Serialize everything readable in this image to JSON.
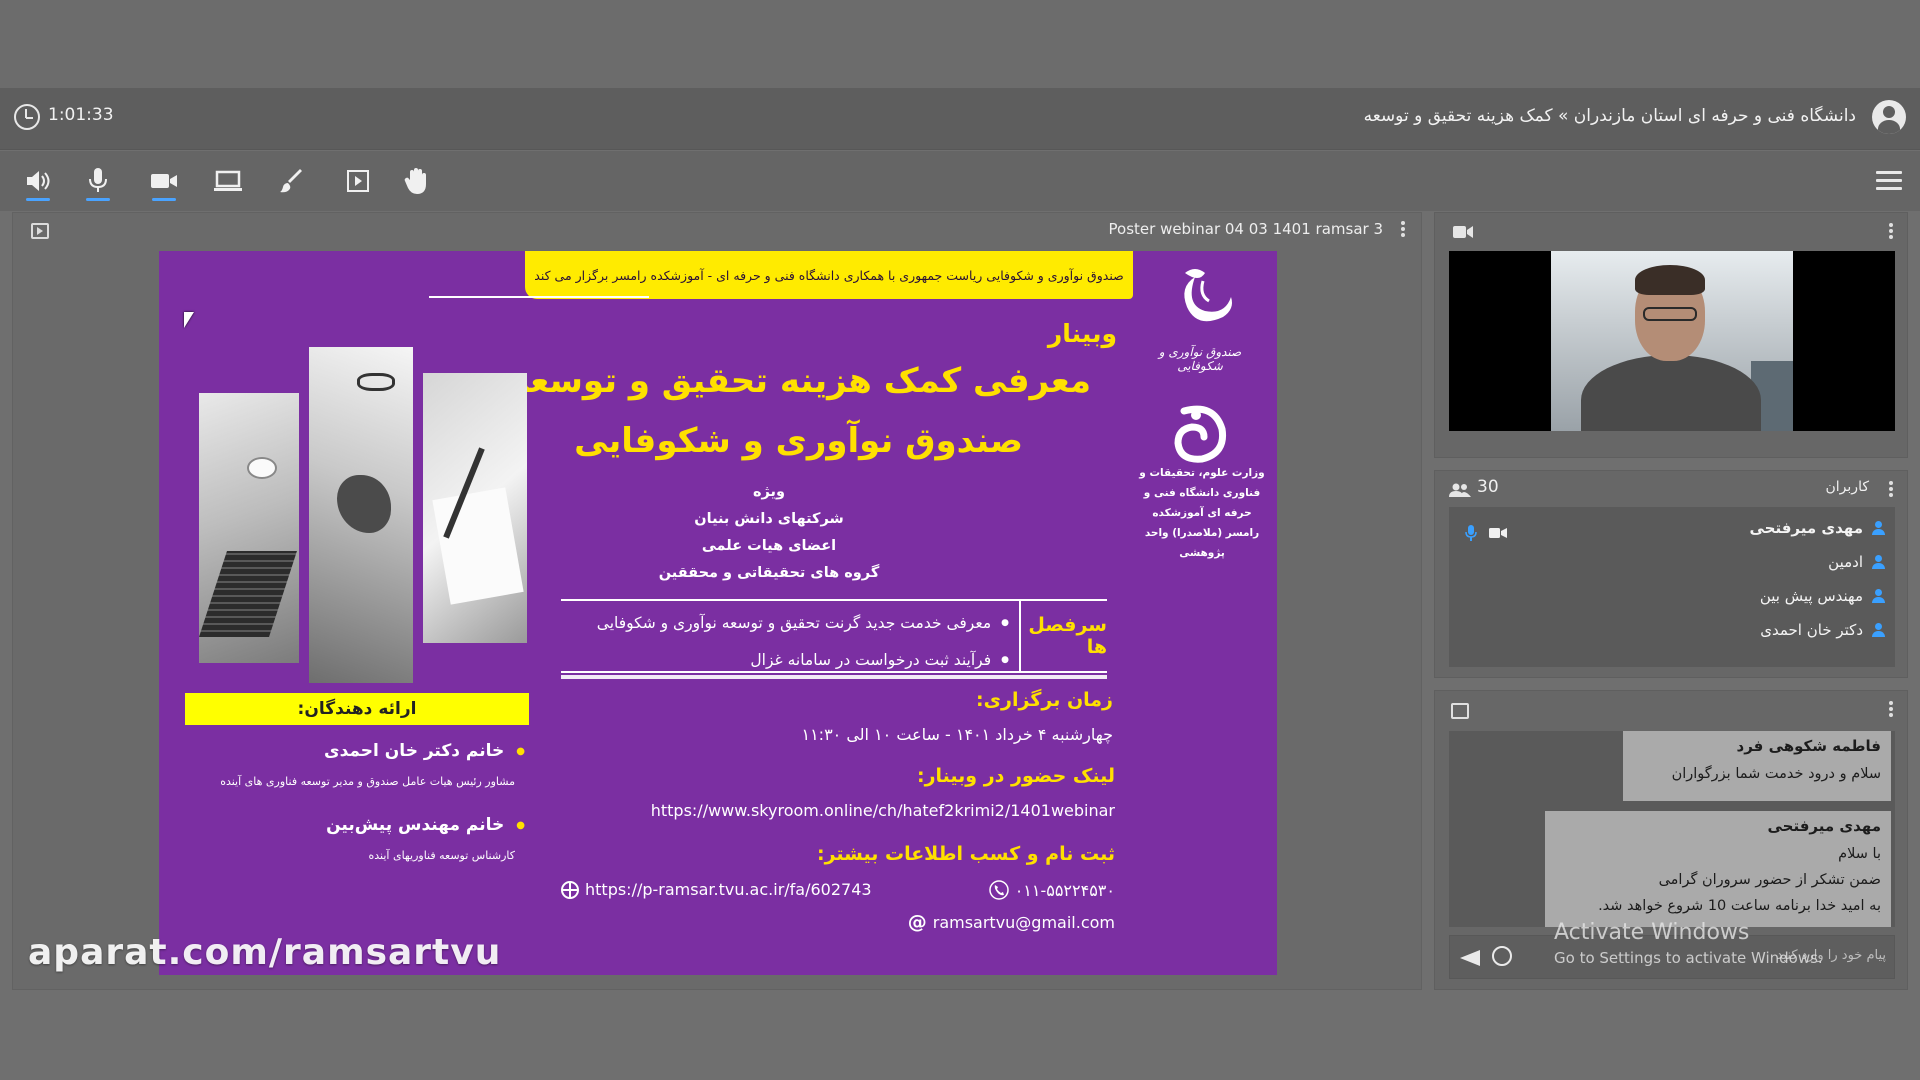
{
  "header": {
    "timer": "1:01:33",
    "room_title": "دانشگاه فنی و حرفه ای استان مازندران » کمک هزینه تحقیق و توسعه"
  },
  "toolbar": {
    "icons": [
      "speaker-icon",
      "microphone-icon",
      "camera-icon",
      "screen-share-icon",
      "brush-icon",
      "play-icon",
      "hand-icon",
      "menu-icon"
    ]
  },
  "content": {
    "file_name": "Poster webinar 04 03 1401 ramsar 3"
  },
  "poster": {
    "banner": "صندوق نوآوری و شکوفایی ریاست جمهوری  با همکاری  دانشگاه فنی و حرفه ای - آموزشکده رامسر  برگزار می کند",
    "fund_logo_text": "صندوق نوآوری و شکوفایی",
    "ministry_text": "وزارت علوم، تحقیقات و فناوری دانشگاه  فنی و حرفه ای آموزشکده رامسر (ملاصدرا) واحد پژوهشی",
    "webinar_label": "وبینار",
    "title_line1": "معرفی کمک هزینه تحقیق و توسعه",
    "title_line2": "صندوق نوآوری و شکوفایی",
    "audience": [
      "ویژه",
      "شرکتهای دانش بنیان",
      "اعضای هیات علمی",
      "گروه های تحقیقاتی و محققین"
    ],
    "topics_label": "سرفصل ها",
    "topics": [
      "معرفی خدمت جدید گرنت تحقیق و توسعه نوآوری و شکوفایی",
      "فرآیند ثبت درخواست در سامانه غزال"
    ],
    "time_label": "زمان برگزاری:",
    "time_value": "چهارشنبه ۴ خرداد ۱۴۰۱ -  ساعت ۱۰ الی ۱۱:۳۰",
    "link_label": "لینک حضور در وبینار:",
    "link_value": "https://www.skyroom.online/ch/hatef2krimi2/1401webinar",
    "register_label": "ثبت نام و کسب اطلاعات بیشتر:",
    "phone": "۰۱۱-۵۵۲۲۴۵۳۰",
    "website": "https://p-ramsar.tvu.ac.ir/fa/602743",
    "email": "ramsartvu@gmail.com",
    "presenters_label": "ارائه دهندگان:",
    "presenter1_name": "خانم دکتر خان احمدی",
    "presenter1_role": "مشاور رئیس هیات عامل صندوق و مدیر توسعه فناوری های آینده",
    "presenter2_name": "خانم مهندس پیش‌بین",
    "presenter2_role": "کارشناس توسعه فناوریهای آینده"
  },
  "watermark": "aparat.com/ramsartvu",
  "users": {
    "count": "30",
    "title": "کاربران",
    "list": [
      "مهدی میرفتحی",
      "ادمین",
      "مهندس پیش بین",
      "دکتر خان احمدی"
    ]
  },
  "chat": {
    "messages": [
      {
        "sender": "فاطمه شکوهی فرد",
        "lines": [
          "سلام و درود خدمت شما بزرگواران"
        ]
      },
      {
        "sender": "مهدی میرفتحی",
        "lines": [
          "با سلام",
          "ضمن تشکر از حضور سروران گرامی",
          "به امید خدا برنامه ساعت 10 شروع خواهد شد."
        ]
      }
    ],
    "placeholder": "پیام خود را وارد کنید"
  },
  "windows_notice": {
    "line1": "Activate Windows",
    "line2": "Go to Settings to activate Windows."
  },
  "colors": {
    "poster_purple": "#7b2fa2",
    "poster_yellow": "#ffe000",
    "accent_blue": "#4aa3ff"
  }
}
